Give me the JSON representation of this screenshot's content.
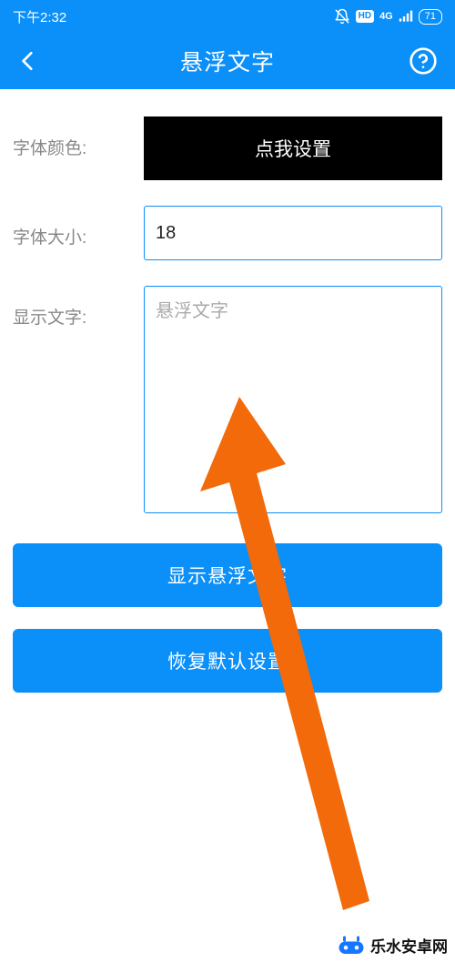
{
  "status": {
    "time": "下午2:32",
    "hd_badge": "HD",
    "network_badge": "4G",
    "battery_text": "71"
  },
  "header": {
    "title": "悬浮文字"
  },
  "form": {
    "font_color_label": "字体颜色:",
    "font_color_button": "点我设置",
    "font_size_label": "字体大小:",
    "font_size_value": "18",
    "display_text_label": "显示文字:",
    "display_text_placeholder": "悬浮文字",
    "display_text_value": ""
  },
  "buttons": {
    "show_floating_text": "显示悬浮文字",
    "restore_defaults": "恢复默认设置"
  },
  "watermark": {
    "text": "乐水安卓网"
  },
  "colors": {
    "primary": "#0b8ff8",
    "arrow": "#f26a0a"
  }
}
